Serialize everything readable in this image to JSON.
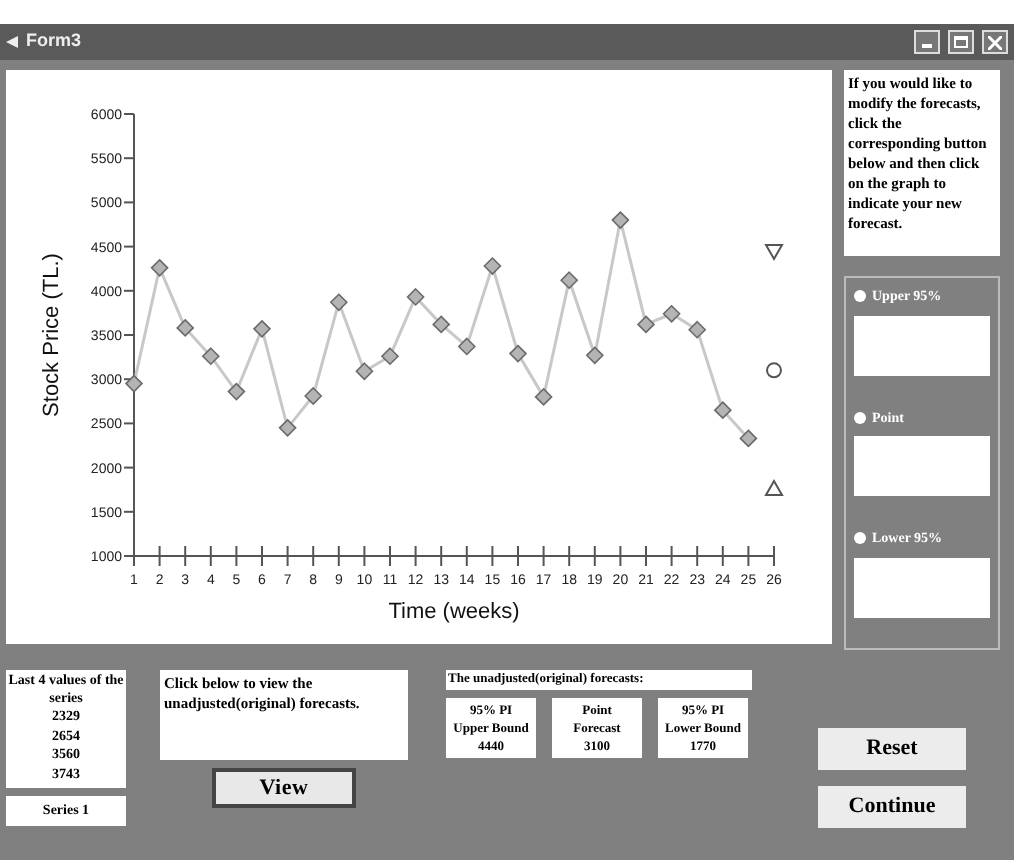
{
  "window": {
    "title": "Form3"
  },
  "chart": {
    "chart_data": {
      "type": "line",
      "xlabel": "Time (weeks)",
      "ylabel": "Stock Price (TL.)",
      "x": [
        1,
        2,
        3,
        4,
        5,
        6,
        7,
        8,
        9,
        10,
        11,
        12,
        13,
        14,
        15,
        16,
        17,
        18,
        19,
        20,
        21,
        22,
        23,
        24,
        25,
        26
      ],
      "xlim": [
        1,
        26
      ],
      "ylim": [
        1000,
        6000
      ],
      "xticks": [
        1,
        2,
        3,
        4,
        5,
        6,
        7,
        8,
        9,
        10,
        11,
        12,
        13,
        14,
        15,
        16,
        17,
        18,
        19,
        20,
        21,
        22,
        23,
        24,
        25,
        26
      ],
      "yticks": [
        1000,
        1500,
        2000,
        2500,
        3000,
        3500,
        4000,
        4500,
        5000,
        5500,
        6000
      ],
      "series": [
        {
          "color": "#c8c8c8",
          "marker": "diamond",
          "values": [
            2950,
            4260,
            3580,
            3260,
            2860,
            3570,
            2450,
            2810,
            3870,
            3090,
            3260,
            3930,
            3620,
            3370,
            4280,
            3290,
            2800,
            4120,
            3270,
            4800,
            3620,
            3740,
            3560,
            2650,
            2330,
            null
          ]
        },
        {
          "color": "#555555",
          "marker": "triangle-down",
          "values": [
            null,
            null,
            null,
            null,
            null,
            null,
            null,
            null,
            null,
            null,
            null,
            null,
            null,
            null,
            null,
            null,
            null,
            null,
            null,
            null,
            null,
            null,
            null,
            null,
            null,
            4440
          ]
        },
        {
          "color": "#555555",
          "marker": "circle",
          "values": [
            null,
            null,
            null,
            null,
            null,
            null,
            null,
            null,
            null,
            null,
            null,
            null,
            null,
            null,
            null,
            null,
            null,
            null,
            null,
            null,
            null,
            null,
            null,
            null,
            null,
            3100
          ]
        },
        {
          "color": "#555555",
          "marker": "triangle-up",
          "values": [
            null,
            null,
            null,
            null,
            null,
            null,
            null,
            null,
            null,
            null,
            null,
            null,
            null,
            null,
            null,
            null,
            null,
            null,
            null,
            null,
            null,
            null,
            null,
            null,
            null,
            1770
          ]
        }
      ]
    }
  },
  "instructions": "If you would like to modify the forecasts, click the corresponding button below and then click on the graph to indicate your new forecast.",
  "adjust_options": [
    {
      "label": "Upper 95%",
      "selected": false
    },
    {
      "label": "Point",
      "selected": false
    },
    {
      "label": "Lower 95%",
      "selected": false
    }
  ],
  "last_values": {
    "title": "Last 4 values of the series",
    "values": [
      "2329",
      "2654",
      "3560",
      "3743"
    ]
  },
  "series_label": "Series 1",
  "view_prompt": "Click below to view the unadjusted(original) forecasts.",
  "view_button": "View",
  "forecasts": {
    "title": "The unadjusted(original) forecasts:",
    "items": [
      {
        "label_1": "95% PI",
        "label_2": "Upper Bound",
        "value": "4440"
      },
      {
        "label_1": "Point",
        "label_2": "Forecast",
        "value": "3100"
      },
      {
        "label_1": "95% PI",
        "label_2": "Lower Bound",
        "value": "1770"
      }
    ]
  },
  "buttons": [
    "Reset",
    "Continue"
  ]
}
